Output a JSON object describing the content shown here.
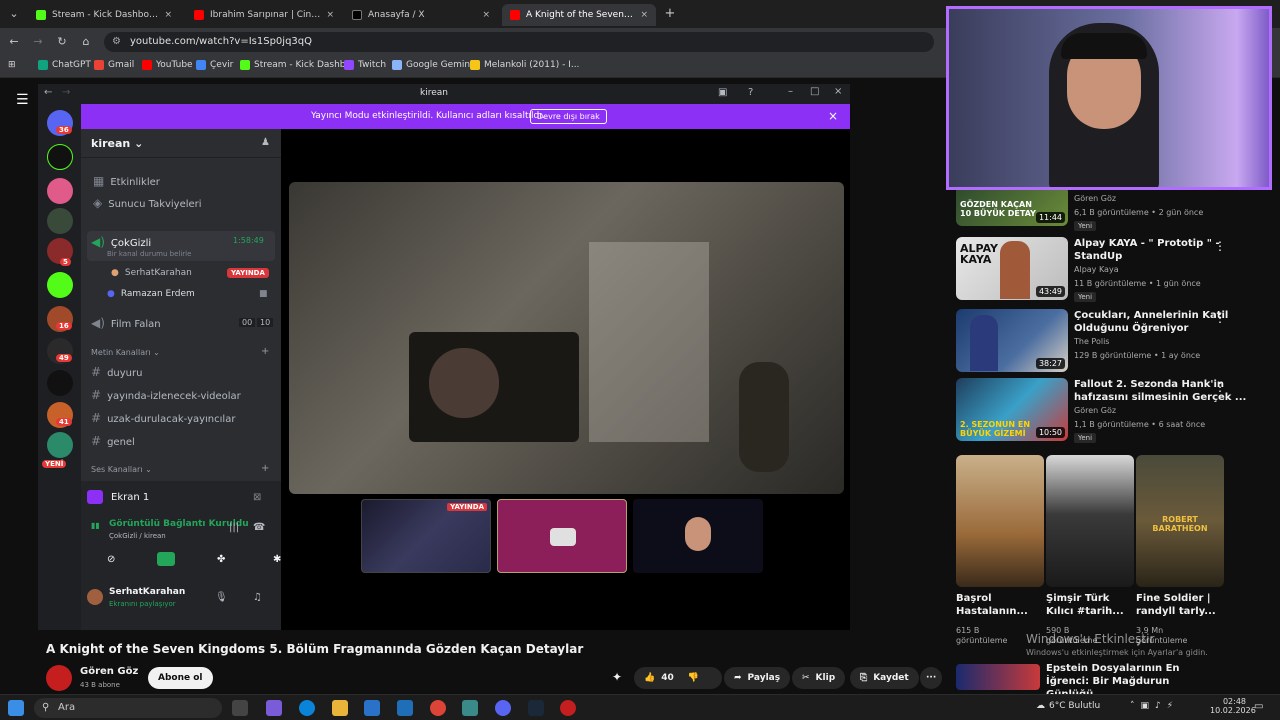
{
  "browser": {
    "tabs": [
      {
        "label": "Stream - Kick Dashboard",
        "color": "#53fc18"
      },
      {
        "label": "İbrahim Sarıpınar | Cin Çık - Yo",
        "color": "#ff0000"
      },
      {
        "label": "Anasayfa / X",
        "color": "#000000"
      },
      {
        "label": "A Knight of the Seven Kingdoms",
        "color": "#ff0000"
      }
    ],
    "close_glyph": "×",
    "new_tab": "+",
    "url": "youtube.com/watch?v=Is1Sp0jq3qQ",
    "bookmarks": [
      {
        "label": "ChatGPT",
        "color": "#10a37f"
      },
      {
        "label": "Gmail",
        "color": "#ea4335"
      },
      {
        "label": "YouTube",
        "color": "#ff0000"
      },
      {
        "label": "Çevir",
        "color": "#4285f4"
      },
      {
        "label": "Stream - Kick Dashb...",
        "color": "#53fc18"
      },
      {
        "label": "Twitch",
        "color": "#9146ff"
      },
      {
        "label": "Google Gemini",
        "color": "#8ab4f8"
      },
      {
        "label": "Melankoli (2011) - I...",
        "color": "#f5c518"
      }
    ]
  },
  "discord": {
    "window_title": "kirean",
    "banner_text": "Yayıncı Modu etkinleştirildi. Kullanıcı adları kısaltıldı.",
    "banner_button": "Devre dışı bırak",
    "server_name": "kirean",
    "menu": [
      "Etkinlikler",
      "Sunucu Takviyeleri"
    ],
    "voice_channel": {
      "name": "ÇokGizli",
      "timer": "1:58:49",
      "status": "Bir kanal durumu belirle"
    },
    "voice_users": [
      {
        "name": "SerhatKarahan",
        "badge": "YAYINDA"
      },
      {
        "name": "Ramazan Erdem"
      }
    ],
    "film_channel": {
      "name": "Film Falan",
      "count_a": "00",
      "count_b": "10"
    },
    "text_category": "Metin Kanalları",
    "text_channels": [
      "duyuru",
      "yayında-izlenecek-videolar",
      "uzak-durulacak-yayıncılar",
      "genel"
    ],
    "voice_category": "Ses Kanalları",
    "screen_share": "Ekran 1",
    "connection": {
      "status": "Görüntülü Bağlantı Kuruldu",
      "sub": "ÇokGizli / kirean"
    },
    "user": {
      "name": "SerhatKarahan",
      "sub": "Ekranını paylaşıyor"
    },
    "server_badges": [
      "36",
      "5",
      "16",
      "49",
      "41",
      "YENİ"
    ],
    "thumb_badge": "YAYINDA"
  },
  "youtube": {
    "recs": [
      {
        "title": "",
        "channel": "Gören Göz",
        "meta": "6,1 B görüntüleme • 2 gün önce",
        "duration": "11:44",
        "badge": "Yeni",
        "thumb": "GÖZDEN KAÇAN 10 BÜYÜK DETAY"
      },
      {
        "title": "Alpay KAYA - \" Prototip \" - StandUp",
        "channel": "Alpay Kaya",
        "meta": "11 B görüntüleme • 1 gün önce",
        "duration": "43:49",
        "badge": "Yeni",
        "thumb": "ALPAY KAYA"
      },
      {
        "title": "Çocukları, Annelerinin Katil Olduğunu Öğreniyor",
        "channel": "The Polis",
        "meta": "129 B görüntüleme • 1 ay önce",
        "duration": "38:27",
        "badge": ""
      },
      {
        "title": "Fallout 2. Sezonda Hank'in hafızasını silmesinin Gerçek ...",
        "channel": "Gören Göz",
        "meta": "1,1 B görüntüleme • 6 saat önce",
        "duration": "10:50",
        "badge": "Yeni",
        "thumb": "2. SEZONUN EN BÜYÜK GİZEMİ"
      }
    ],
    "shorts": [
      {
        "title": "Başrol Hastalanın...",
        "views": "615 B görüntüleme"
      },
      {
        "title": "Şimşir Türk Kılıcı #tarih...",
        "views": "590 B görüntüleme"
      },
      {
        "title": "Fine Soldier | randyll tarly...",
        "views": "3,9 Mn görüntüleme",
        "thumb": "ROBERT BARATHEON"
      }
    ],
    "last_rec": "Epstein Dosyalarının En İğrenci: Bir Mağdurun Günlüğü",
    "video_title": "A Knight of the Seven Kingdoms 5. Bölüm Fragmanında Gözden Kaçan Detaylar",
    "channel": "Gören Göz",
    "subs": "43 B abone",
    "subscribe": "Abone ol",
    "likes": "40",
    "share": "Paylaş",
    "clip": "Klip",
    "save": "Kaydet",
    "more": "···"
  },
  "windows": {
    "watermark": "Windows'u Etkinleştir",
    "watermark_sub": "Windows'u etkinleştirmek için Ayarlar'a gidin.",
    "search": "Ara",
    "weather": "6°C Bulutlu",
    "time": "02:48",
    "date": "10.02.2026"
  }
}
